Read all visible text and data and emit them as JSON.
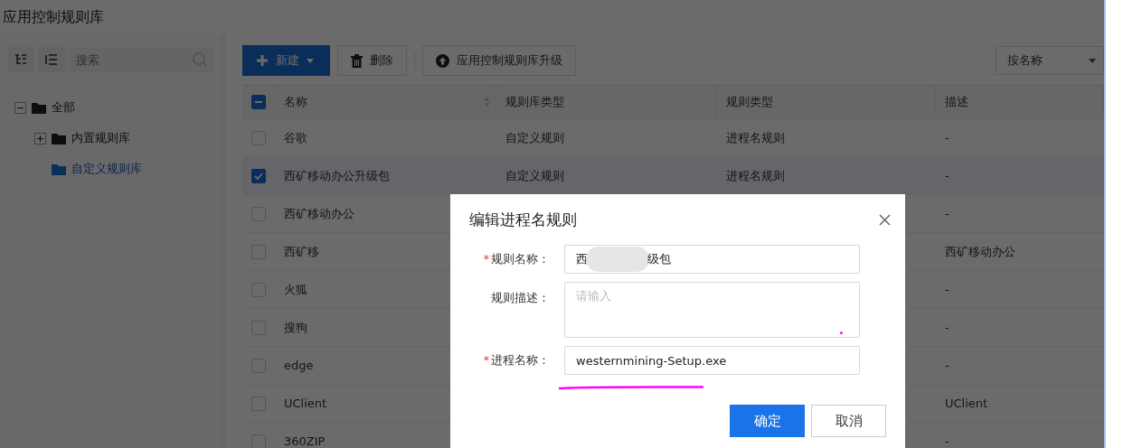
{
  "page_title": "应用控制规则库",
  "sidebar": {
    "search": {
      "placeholder": "搜索"
    },
    "tree": [
      {
        "label": "全部",
        "expanded": true,
        "selected": false,
        "children": [
          {
            "label": "内置规则库",
            "expanded": false,
            "selected": false
          },
          {
            "label": "自定义规则库",
            "selected": true
          }
        ]
      }
    ]
  },
  "toolbar": {
    "buttons": [
      {
        "label": "新建",
        "kind": "primary"
      },
      {
        "label": "删除",
        "kind": "delete"
      },
      {
        "label": "应用控制规则库升级",
        "kind": "upgrade"
      }
    ],
    "sort_select": {
      "value": "按名称"
    }
  },
  "table": {
    "header_checkbox": {
      "indeterminate": true
    },
    "columns": [
      "名称",
      "规则库类型",
      "规则类型",
      "描述"
    ],
    "rows": [
      {
        "checked": false,
        "cells": [
          "谷歌",
          "自定义规则",
          "进程名规则",
          "-"
        ]
      },
      {
        "checked": true,
        "cells": [
          "西矿移动办公升级包",
          "自定义规则",
          "进程名规则",
          "-"
        ]
      },
      {
        "checked": false,
        "cells": [
          "西矿移动办公",
          null,
          null,
          "-"
        ]
      },
      {
        "checked": false,
        "cells": [
          "西矿移",
          null,
          null,
          "西矿移动办公"
        ]
      },
      {
        "checked": false,
        "cells": [
          "火狐",
          null,
          null,
          "-"
        ]
      },
      {
        "checked": false,
        "cells": [
          "搜狗",
          null,
          null,
          "-"
        ]
      },
      {
        "checked": false,
        "cells": [
          "edge",
          null,
          null,
          "-"
        ]
      },
      {
        "checked": false,
        "cells": [
          "UClient",
          null,
          null,
          "UClient"
        ]
      },
      {
        "checked": false,
        "cells": [
          "360ZIP",
          null,
          null,
          "-"
        ]
      }
    ]
  },
  "dialog": {
    "title": "编辑进程名规则",
    "fields": [
      {
        "label": "规则名称：",
        "required_mark": "*",
        "kind": "redacted",
        "value_parts": [
          "西",
          "级包"
        ]
      },
      {
        "label": "规则描述：",
        "kind": "textarea",
        "placeholder": "请输入"
      },
      {
        "label": "进程名称：",
        "required_mark": "*",
        "kind": "input",
        "value": "westernmining-Setup.exe"
      }
    ],
    "buttons": [
      {
        "label": "确定",
        "kind": "primary"
      },
      {
        "label": "取消",
        "kind": "default"
      }
    ]
  }
}
